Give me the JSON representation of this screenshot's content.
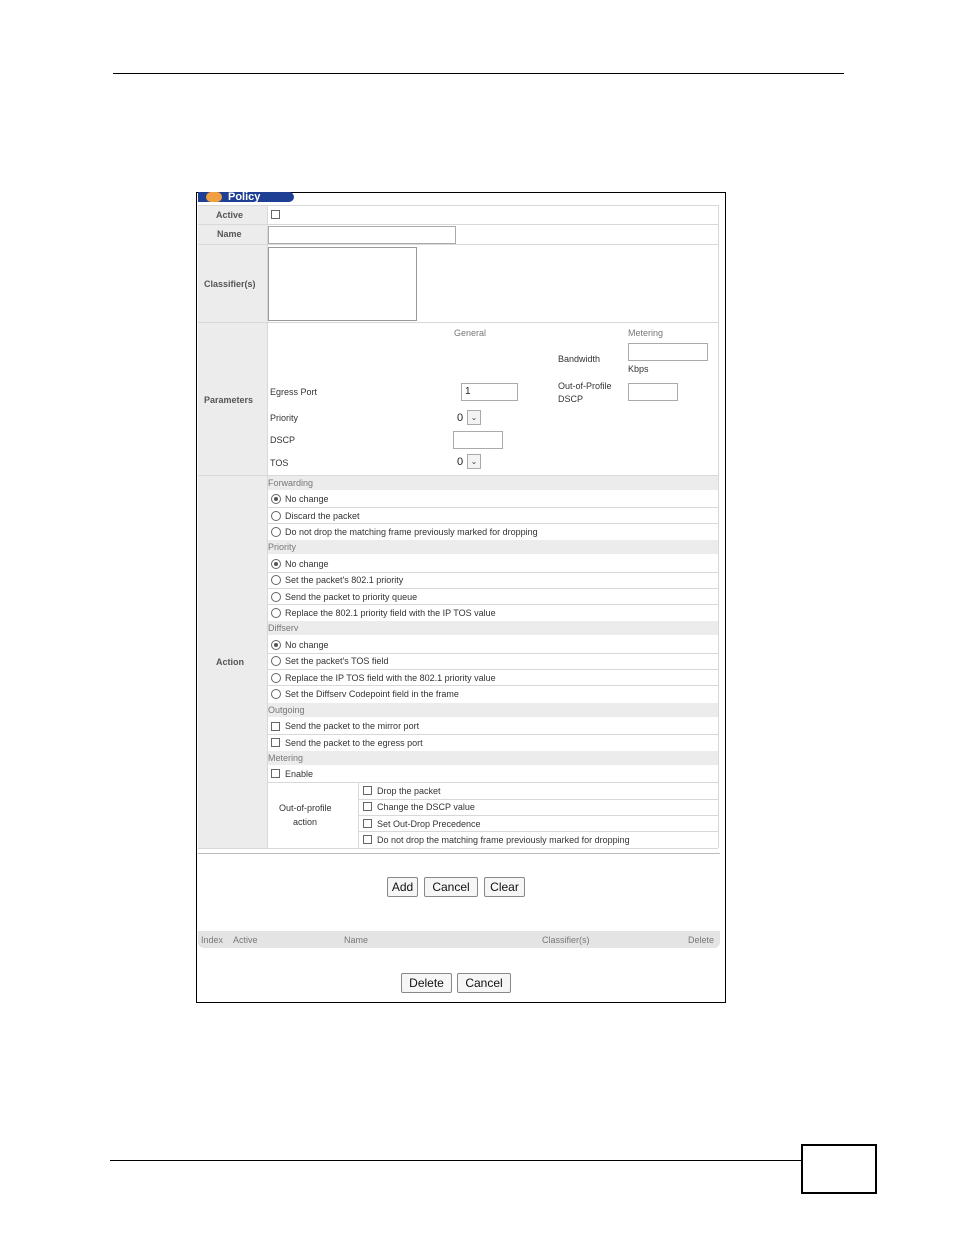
{
  "policy": {
    "tab_title": "Policy",
    "fields": {
      "active_label": "Active",
      "name_label": "Name",
      "name_value": "",
      "classifiers_label": "Classifier(s)",
      "parameters_label": "Parameters",
      "action_label": "Action"
    },
    "parameters": {
      "general_header": "General",
      "metering_header": "Metering",
      "bandwidth_label": "Bandwidth",
      "bandwidth_value": "",
      "kbps_label": "Kbps",
      "out_of_profile_dscp_label_1": "Out-of-Profile",
      "out_of_profile_dscp_label_2": "DSCP",
      "out_of_profile_dscp_value": "",
      "egress_port_label": "Egress Port",
      "egress_port_value": "1",
      "priority_label": "Priority",
      "priority_value": "0",
      "dscp_label": "DSCP",
      "dscp_value": "",
      "tos_label": "TOS",
      "tos_value": "0"
    },
    "action": {
      "forwarding": {
        "title": "Forwarding",
        "options": [
          "No change",
          "Discard the packet",
          "Do not drop the matching frame previously marked for dropping"
        ],
        "selected": 0
      },
      "priority": {
        "title": "Priority",
        "options": [
          "No change",
          "Set the packet's 802.1 priority",
          "Send the packet to priority queue",
          "Replace the 802.1 priority field with the IP TOS value"
        ],
        "selected": 0
      },
      "diffserv": {
        "title": "Diffserv",
        "options": [
          "No change",
          "Set the packet's TOS field",
          "Replace the IP TOS field with the 802.1 priority value",
          "Set the Diffserv Codepoint field in the frame"
        ],
        "selected": 0
      },
      "outgoing": {
        "title": "Outgoing",
        "options": [
          "Send the packet to the mirror port",
          "Send the packet to the egress port"
        ]
      },
      "metering": {
        "title": "Metering",
        "enable_label": "Enable",
        "out_of_profile_label_1": "Out-of-profile",
        "out_of_profile_label_2": "action",
        "options": [
          "Drop the packet",
          "Change the DSCP value",
          "Set Out-Drop Precedence",
          "Do not drop the matching frame previously marked for dropping"
        ]
      }
    },
    "buttons": {
      "add": "Add",
      "cancel": "Cancel",
      "clear": "Clear"
    },
    "table": {
      "headers": [
        "Index",
        "Active",
        "Name",
        "Classifier(s)",
        "Delete"
      ]
    },
    "bottom_buttons": {
      "delete": "Delete",
      "cancel": "Cancel"
    }
  }
}
